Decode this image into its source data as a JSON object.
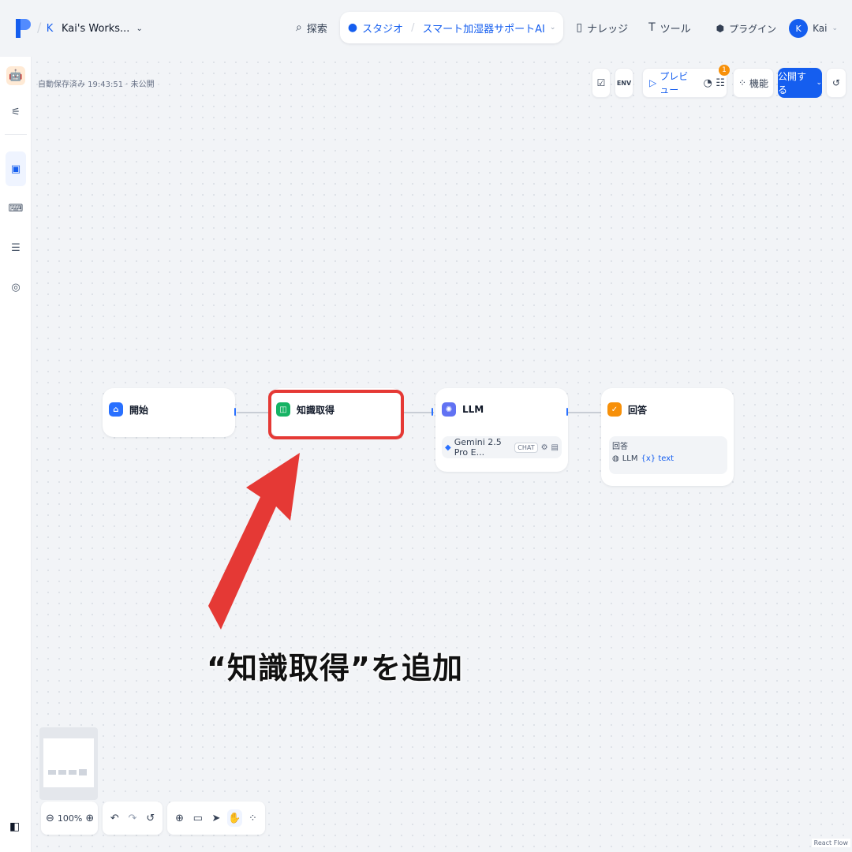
{
  "header": {
    "workspace_initial": "K",
    "workspace_name": "Kai's Works...",
    "nav": {
      "explore": "探索",
      "studio": "スタジオ",
      "app_name": "スマート加湿器サポートAI",
      "knowledge": "ナレッジ",
      "tools": "ツール"
    },
    "plugin_label": "プラグイン",
    "user_initial": "K",
    "user_name": "Kai"
  },
  "canvas": {
    "autosave_text": "自動保存済み 19:43:51 · 未公開",
    "toolbar": {
      "env_label": "ENV",
      "preview_label": "プレビュー",
      "badge_count": "1",
      "features_label": "機能",
      "publish_label": "公開する"
    },
    "nodes": {
      "start": {
        "title": "開始"
      },
      "knowledge": {
        "title": "知識取得"
      },
      "llm": {
        "title": "LLM",
        "model": "Gemini 2.5 Pro E...",
        "mode_chip": "CHAT"
      },
      "answer": {
        "title": "回答",
        "field_label": "回答",
        "source_node": "LLM",
        "variable": "{x} text"
      }
    },
    "annotation": "“知識取得”を追加",
    "zoom": "100%",
    "react_flow": "React Flow"
  },
  "colors": {
    "primary": "#155eef",
    "start_icon": "#2970ff",
    "knowledge_icon": "#16b364",
    "llm_icon": "#6172f3",
    "answer_icon": "#f79009",
    "highlight": "#e53935",
    "arrow": "#e53935"
  },
  "icons": [
    "search-icon",
    "robot-icon",
    "book-icon",
    "tool-icon",
    "plugin-icon",
    "home-icon",
    "brain-icon",
    "check-icon",
    "history-icon",
    "undo-icon",
    "redo-icon",
    "hand-icon",
    "pointer-icon"
  ]
}
